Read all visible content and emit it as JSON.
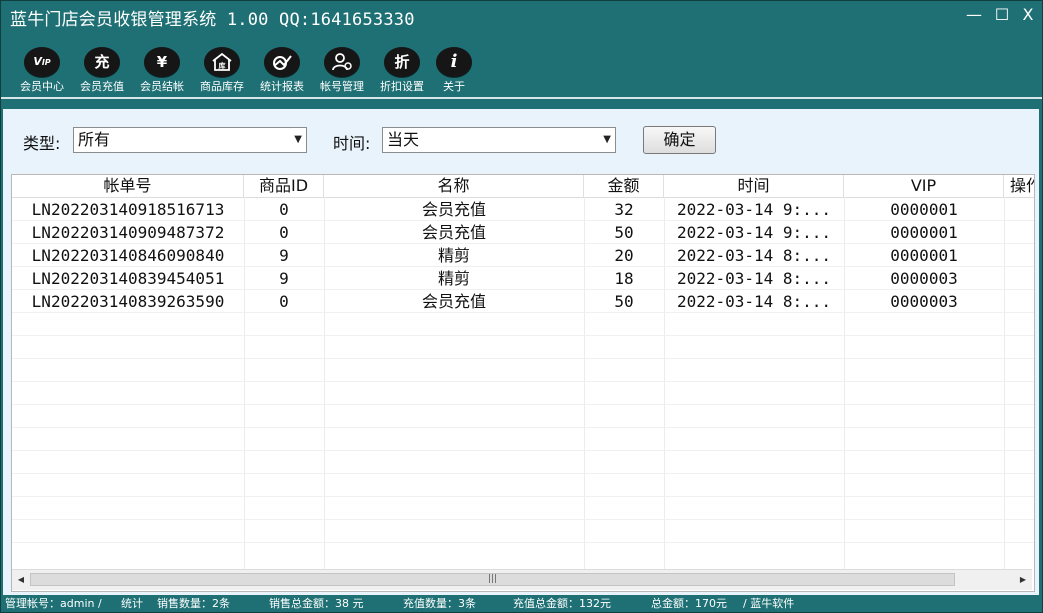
{
  "window": {
    "title": "蓝牛门店会员收银管理系统 1.00    QQ:1641653330",
    "minimize": "—",
    "maximize": "☐",
    "close": "X"
  },
  "toolbar": [
    {
      "icon": "vip-icon",
      "glyph": "VIP",
      "label": "会员中心"
    },
    {
      "icon": "recharge-icon",
      "glyph": "充",
      "label": "会员充值"
    },
    {
      "icon": "yen-icon",
      "glyph": "¥",
      "label": "会员结帐"
    },
    {
      "icon": "warehouse-icon",
      "glyph": "库",
      "label": "商品库存"
    },
    {
      "icon": "chart-icon",
      "glyph": "≪",
      "label": "统计报表"
    },
    {
      "icon": "user-settings-icon",
      "glyph": "⚙",
      "label": "帐号管理"
    },
    {
      "icon": "discount-icon",
      "glyph": "折",
      "label": "折扣设置"
    },
    {
      "icon": "info-icon",
      "glyph": "i",
      "label": "关于"
    }
  ],
  "filter": {
    "type_label": "类型:",
    "type_value": "所有",
    "time_label": "时间:",
    "time_value": "当天",
    "confirm_label": "确定"
  },
  "table": {
    "columns": [
      "帐单号",
      "商品ID",
      "名称",
      "金额",
      "时间",
      "VIP",
      "操作"
    ],
    "rows": [
      [
        "LN20220314091851671 3",
        "0",
        "会员充值",
        "32",
        "2022-03-14 9:...",
        "0000001"
      ],
      [
        "LN202203140909487372",
        "0",
        "会员充值",
        "50",
        "2022-03-14 9:...",
        "0000001"
      ],
      [
        "LN202203140846090840",
        "9",
        "精剪",
        "20",
        "2022-03-14 8:...",
        "0000001"
      ],
      [
        "LN202203140839454051",
        "9",
        "精剪",
        "18",
        "2022-03-14 8:...",
        "0000003"
      ],
      [
        "LN202203140839263590",
        "0",
        "会员充值",
        "50",
        "2022-03-14 8:...",
        "0000003"
      ]
    ]
  },
  "status": {
    "account": "管理帐号：admin /",
    "stats": "统计",
    "sales_count": "销售数量：2条",
    "sales_total": "销售总金额：38 元",
    "recharge_count": "充值数量：3条",
    "recharge_total": "充值总金额：132元",
    "grand_total": "总金额：170元",
    "vendor": "/ 蓝牛软件"
  },
  "colors": {
    "window_bg": "#1e7074",
    "content_bg": "#e9f3fb"
  }
}
